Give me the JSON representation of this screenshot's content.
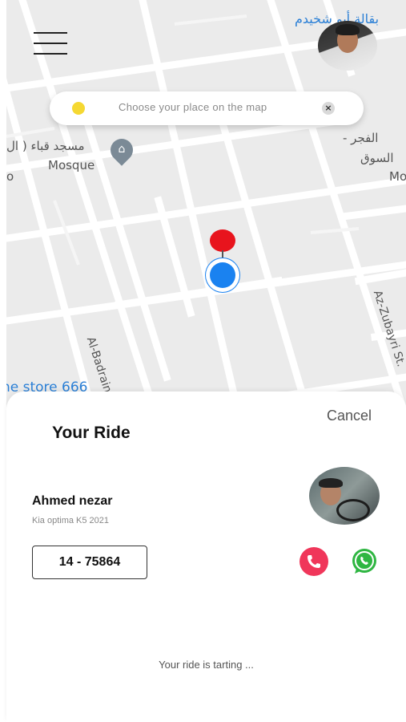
{
  "map": {
    "poi": {
      "arabic_name": "مسجد قباء ( ال",
      "type_label": "Mosque"
    },
    "top_store_label": "بقالة أبو شخيدم",
    "right_label_1": "الفجر -",
    "right_label_2": "السوق",
    "right_label_3": "Mo",
    "left_partial": "( ال",
    "left_partial_2": "o",
    "store_label": "ne store 666",
    "street_1": "Al-Badrain St.",
    "street_2": "Az-Zubayri St.",
    "pin_color": "#e8141d",
    "location_color": "#1a82f0"
  },
  "header": {
    "menu_icon": "hamburger-icon"
  },
  "search": {
    "placeholder": "Choose your place on the map",
    "dot_color": "#f5d832",
    "clear_icon": "close-icon",
    "clear_glyph": "×"
  },
  "ride": {
    "cancel_label": "Cancel",
    "title": "Your Ride",
    "driver_name": "Ahmed nezar",
    "car_model": "Kia optima K5 2021",
    "plate_number": "14 - 75864",
    "call_color": "#f0365a",
    "whatsapp_color": "#2fb642",
    "status_text": "Your ride is tarting ..."
  }
}
